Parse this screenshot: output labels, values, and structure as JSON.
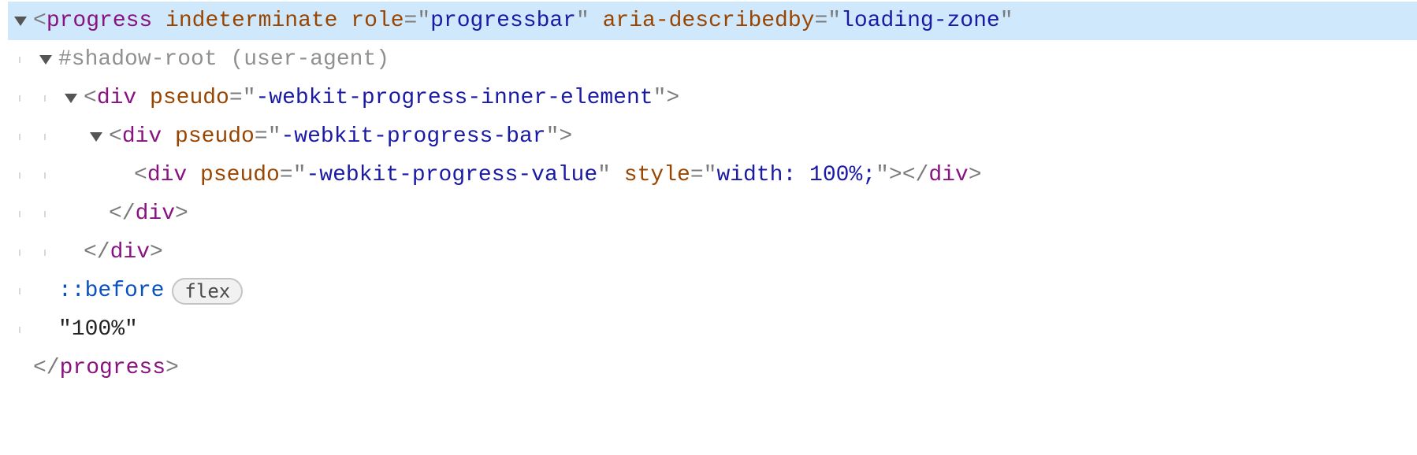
{
  "lines": {
    "l0": {
      "tag_open": "<",
      "tag_name": "progress",
      "attr1_name": "indeterminate",
      "attr2_name": "role",
      "attr2_val": "progressbar",
      "attr3_name": "aria-describedby",
      "attr3_val": "loading-zone"
    },
    "l1": {
      "text": "#shadow-root (user-agent)"
    },
    "l2": {
      "tag_open": "<",
      "tag_name": "div",
      "attr1_name": "pseudo",
      "attr1_val": "-webkit-progress-inner-element",
      "tag_close": ">"
    },
    "l3": {
      "tag_open": "<",
      "tag_name": "div",
      "attr1_name": "pseudo",
      "attr1_val": "-webkit-progress-bar",
      "tag_close": ">"
    },
    "l4": {
      "tag_open": "<",
      "tag_name": "div",
      "attr1_name": "pseudo",
      "attr1_val": "-webkit-progress-value",
      "attr2_name": "style",
      "attr2_val": "width: 100%;",
      "tag_close": ">",
      "close_open": "</",
      "close_name": "div",
      "close_end": ">"
    },
    "l5": {
      "close_open": "</",
      "close_name": "div",
      "close_end": ">"
    },
    "l6": {
      "close_open": "</",
      "close_name": "div",
      "close_end": ">"
    },
    "l7": {
      "selector": "::before",
      "badge": "flex"
    },
    "l8": {
      "text": "\"100%\""
    },
    "l9": {
      "close_open": "</",
      "close_name": "progress",
      "close_end": ">"
    }
  }
}
